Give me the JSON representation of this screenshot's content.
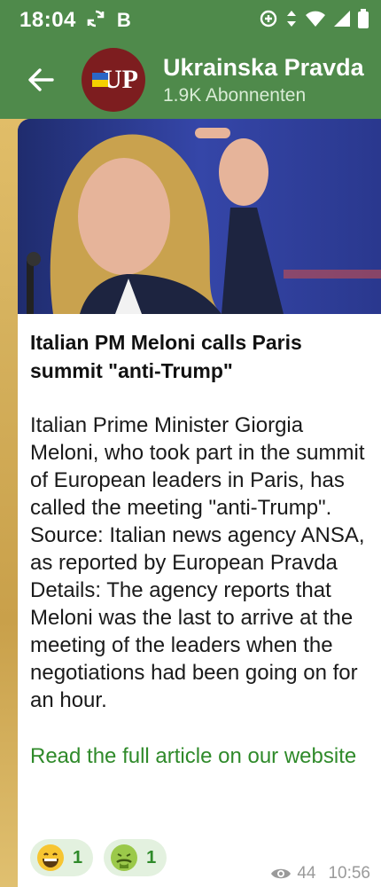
{
  "status_bar": {
    "time": "18:04",
    "left_icons": [
      "sync-icon",
      "b-icon"
    ],
    "right_icons": [
      "data-saver-icon",
      "data-arrows-icon",
      "wifi-icon",
      "signal-icon",
      "battery-icon"
    ]
  },
  "header": {
    "title": "Ukrainska Pravda",
    "subtitle": "1.9K Abonnenten",
    "avatar_text": "UP"
  },
  "message": {
    "headline": "Italian PM Meloni calls Paris summit \"anti-Trump\"",
    "body": "Italian Prime Minister Giorgia Meloni, who took part in the summit of European leaders in Paris, has called the meeting \"anti-Trump\". Source: Italian news agency ANSA, as reported by European Pravda Details: The agency reports that Meloni was the last to arrive at the meeting of the leaders when the negotiations had been going on for an hour.",
    "link_text": "Read the full article on our website",
    "reactions": [
      {
        "emoji": "grinning-face",
        "count": "1"
      },
      {
        "emoji": "nauseated-face",
        "count": "1"
      }
    ],
    "views": "44",
    "time": "10:56"
  },
  "colors": {
    "header_green": "#4f8a4b",
    "link_green": "#2f8a2a",
    "reaction_bg": "#e3f1df"
  }
}
